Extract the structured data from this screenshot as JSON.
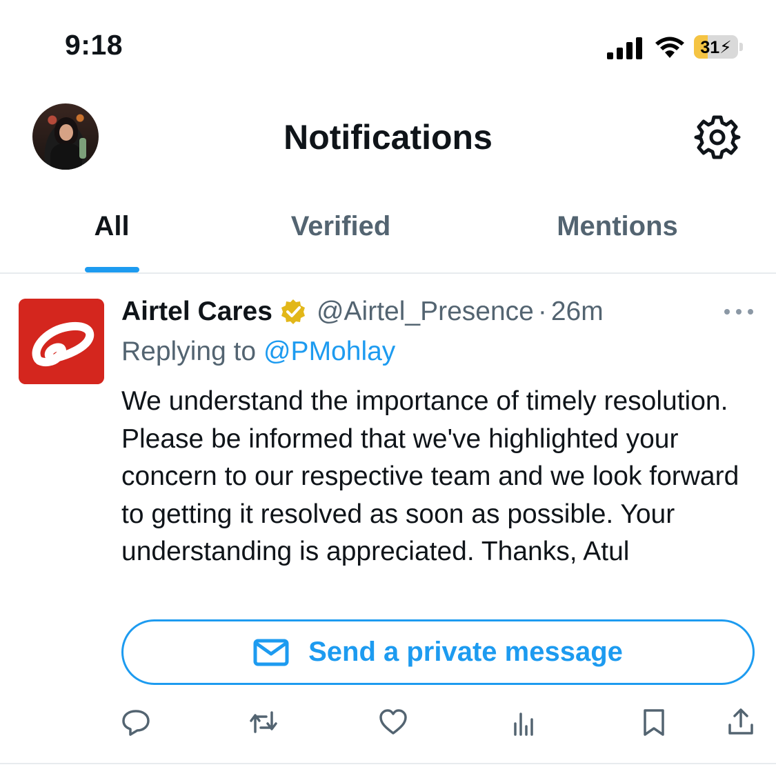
{
  "status_bar": {
    "time": "9:18",
    "battery_percent": "31",
    "battery_level": 0.31,
    "battery_color": "#f5c443"
  },
  "header": {
    "title": "Notifications",
    "avatar_icon": "profile-photo",
    "settings_icon": "gear-icon"
  },
  "tabs": [
    {
      "label": "All",
      "active": true
    },
    {
      "label": "Verified",
      "active": false
    },
    {
      "label": "Mentions",
      "active": false
    }
  ],
  "tweet": {
    "author_name": "Airtel Cares",
    "verified_badge": "gold-verified-icon",
    "handle": "@Airtel_Presence",
    "separator": "·",
    "time_ago": "26m",
    "reply_prefix": "Replying to",
    "reply_to": "@PMohlay",
    "text": "We understand the importance of timely resolution. Please be informed that we've highlighted your concern to our respective team and we look forward to getting it resolved as soon as possible. Your understanding is appreciated. Thanks, Atul",
    "dm_button_label": "Send a private message",
    "actions": [
      "reply-icon",
      "retweet-icon",
      "like-icon",
      "views-icon",
      "bookmark-icon",
      "share-icon"
    ]
  },
  "colors": {
    "accent": "#1d9bf0",
    "brand_red": "#d4261e",
    "secondary_text": "#536471",
    "primary_text": "#0f1419",
    "verified_gold": "#e2b719"
  }
}
